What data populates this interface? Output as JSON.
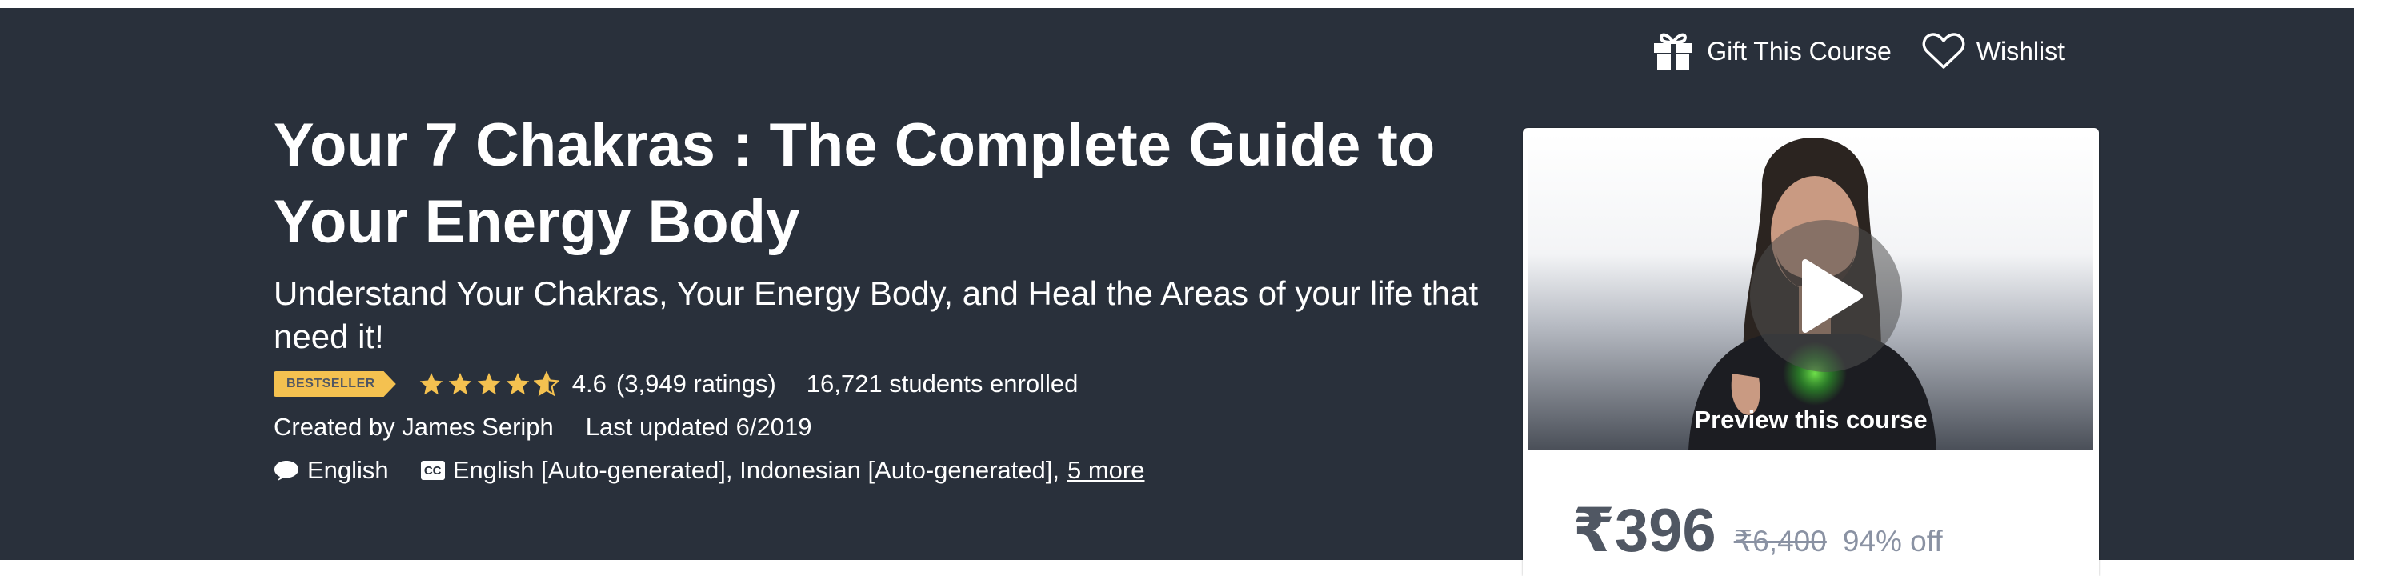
{
  "header": {
    "gift_label": "Gift This Course",
    "wishlist_label": "Wishlist"
  },
  "course": {
    "title": "Your 7 Chakras : The Complete Guide to Your Energy Body",
    "subtitle": "Understand Your Chakras, Your Energy Body, and Heal the Areas of your life that need it!",
    "badge": "BESTSELLER",
    "rating": "4.6",
    "ratings_count": "(3,949 ratings)",
    "students": "16,721 students enrolled",
    "stars_rating_value": 4.6,
    "created_by": "Created by James Seriph",
    "last_updated": "Last updated 6/2019",
    "language": "English",
    "captions": "English [Auto-generated], Indonesian [Auto-generated],",
    "captions_more": "5 more",
    "cc_label": "CC"
  },
  "card": {
    "preview_label": "Preview this course",
    "price": "₹396",
    "original_price": "₹6,400",
    "discount": "94% off"
  },
  "colors": {
    "banner_bg": "#29303b",
    "badge": "#f4c150",
    "star": "#f4c150",
    "price": "#505763"
  },
  "icons": {
    "gift": "gift-icon",
    "wishlist": "heart-icon",
    "language": "speech-bubble-icon",
    "captions": "cc-icon",
    "play": "play-icon",
    "star": "star-icon"
  }
}
